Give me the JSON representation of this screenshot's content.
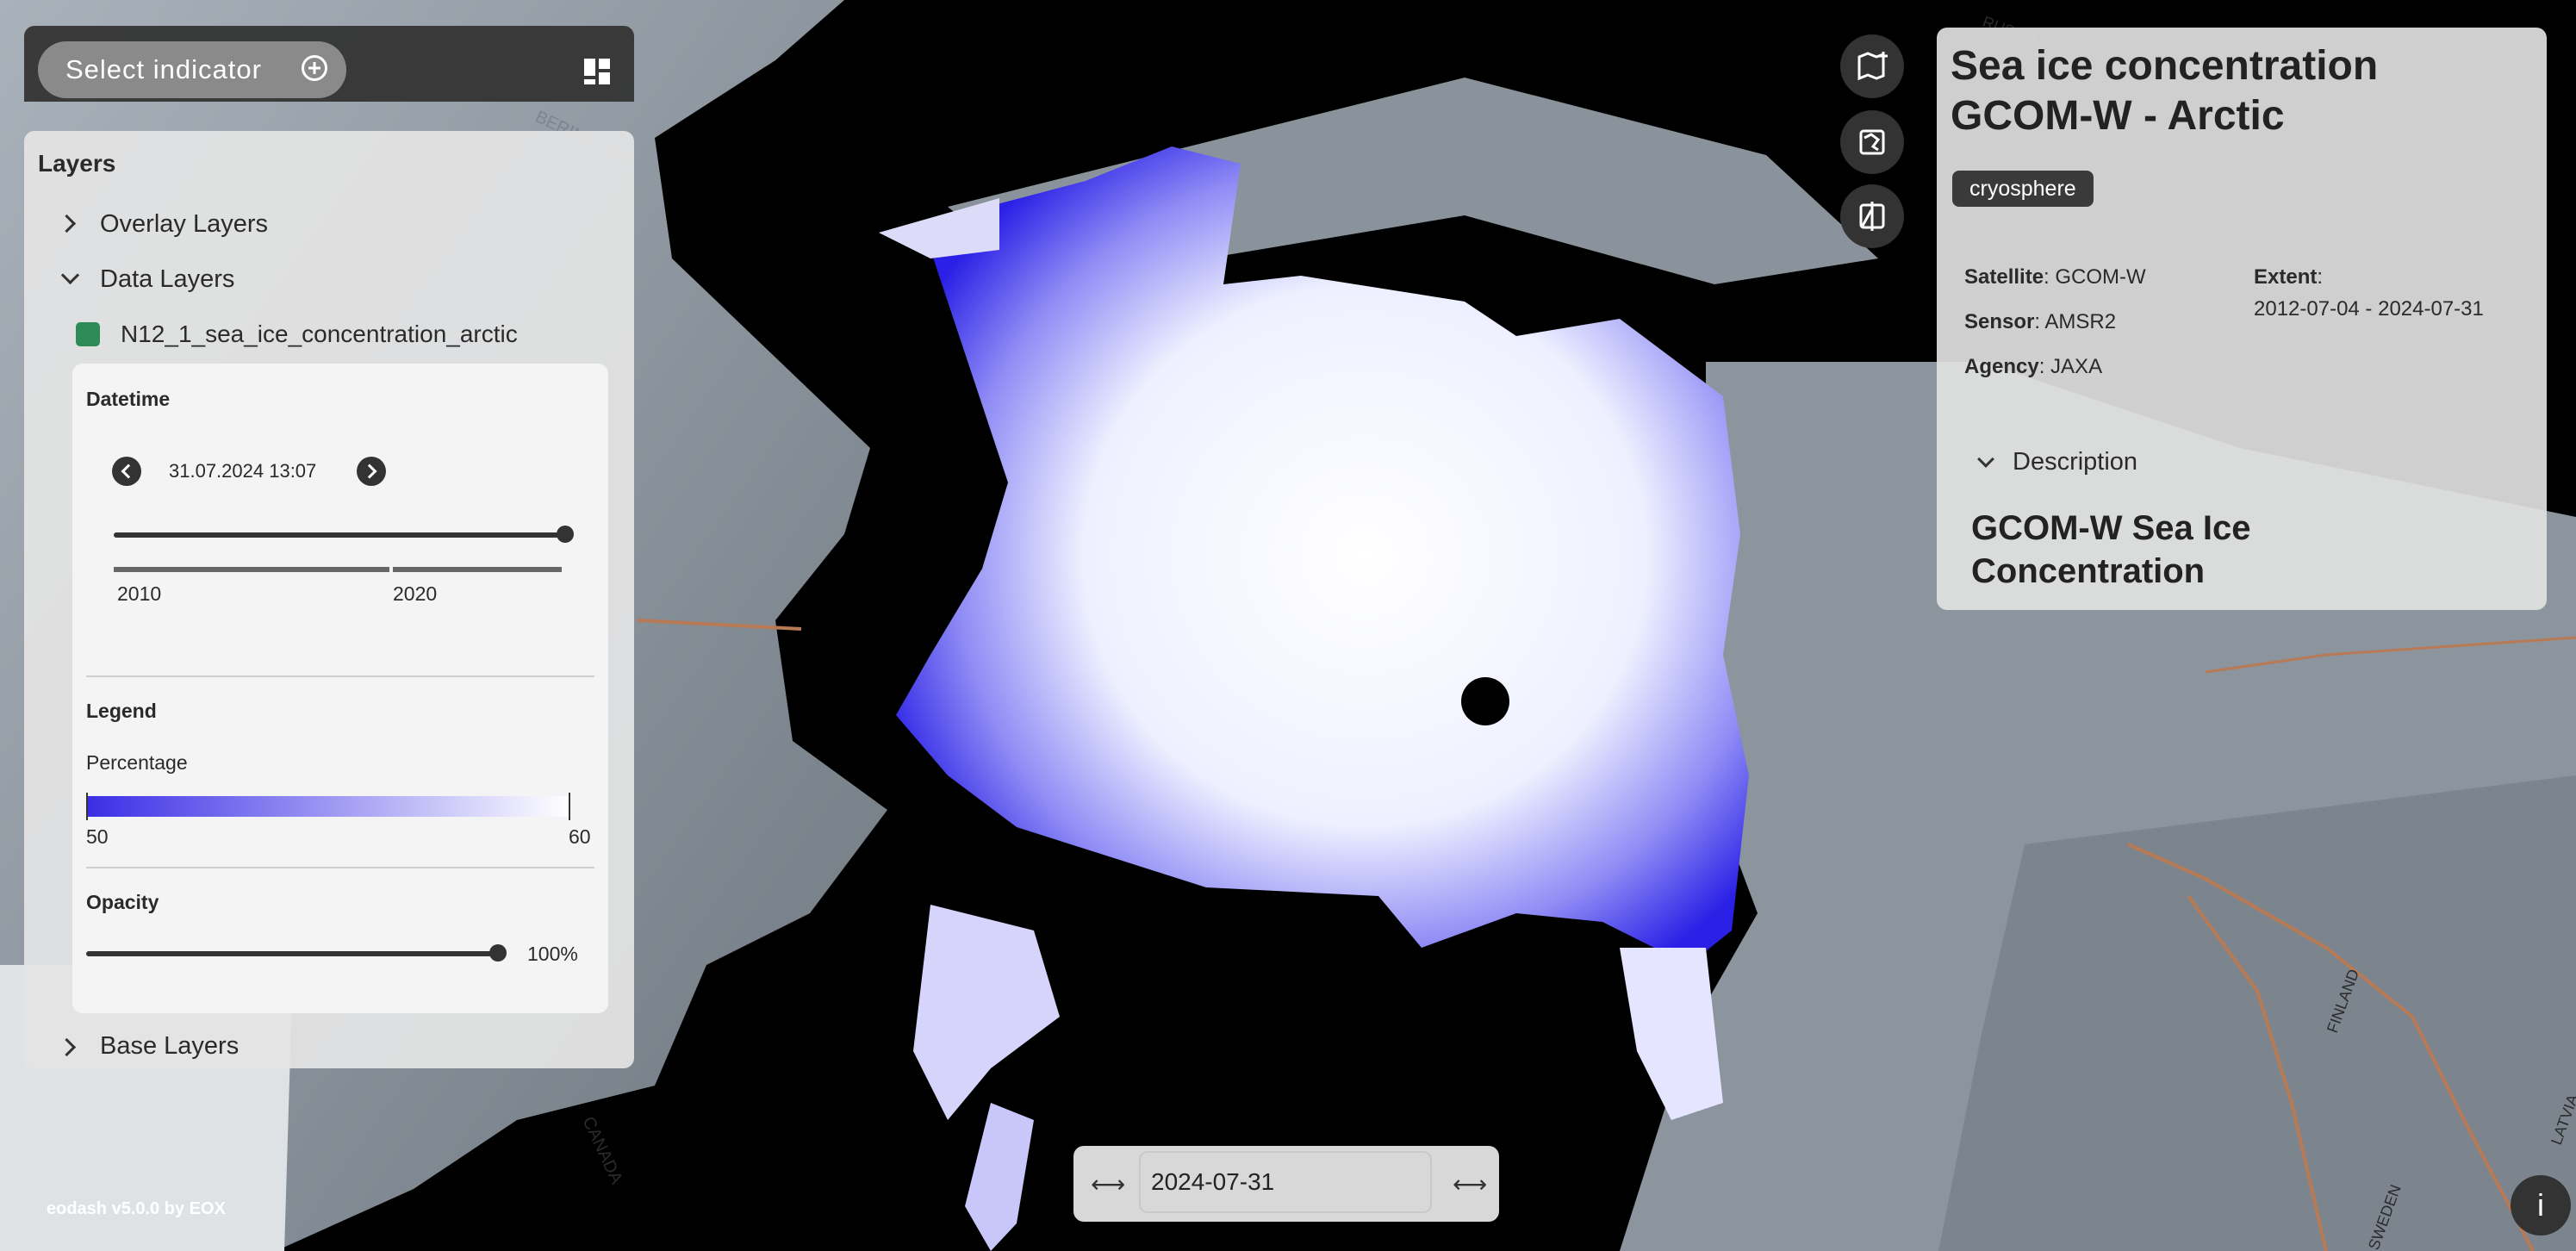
{
  "header": {
    "select_indicator_label": "Select indicator",
    "grid_icon": "grid-icon",
    "add_icon": "plus-circle-icon"
  },
  "layers": {
    "title": "Layers",
    "overlay_label": "Overlay Layers",
    "data_label": "Data Layers",
    "layer_name": "N12_1_sea_ice_concentration_arctic",
    "layer_color": "#2e8b57",
    "datetime_title": "Datetime",
    "datetime_value": "31.07.2024 13:07",
    "timeline_ticks": [
      "2010",
      "2020"
    ],
    "legend_title": "Legend",
    "legend_unit": "Percentage",
    "legend_min": "50",
    "legend_max": "60",
    "legend_colors": [
      "#3a2ee6",
      "#ffffff"
    ],
    "opacity_title": "Opacity",
    "opacity_value": "100%",
    "opacity_fraction": 1.0,
    "base_label": "Base Layers"
  },
  "info": {
    "title": "Sea ice concentration GCOM-W - Arctic",
    "tag": "cryosphere",
    "satellite_key": "Satellite",
    "satellite_val": "GCOM-W",
    "sensor_key": "Sensor",
    "sensor_val": "AMSR2",
    "agency_key": "Agency",
    "agency_val": "JAXA",
    "extent_key": "Extent",
    "extent_val": "2012-07-04 - 2024-07-31",
    "description_label": "Description",
    "description_heading": "GCOM-W Sea Ice Concentration"
  },
  "map_buttons": [
    "map-add-icon",
    "globe-icon",
    "compare-icon"
  ],
  "map_labels": [
    "BERING SEA",
    "CANADA",
    "FINLAND",
    "SWEDEN",
    "LATVIA",
    "RUSSIA"
  ],
  "date_control": {
    "value": "2024-07-31",
    "prev_icon": "arrow-left-right-icon",
    "next_icon": "arrow-left-right-icon"
  },
  "footer": {
    "text": "eodash v5.0.0 by EOX"
  },
  "info_button_label": "i"
}
